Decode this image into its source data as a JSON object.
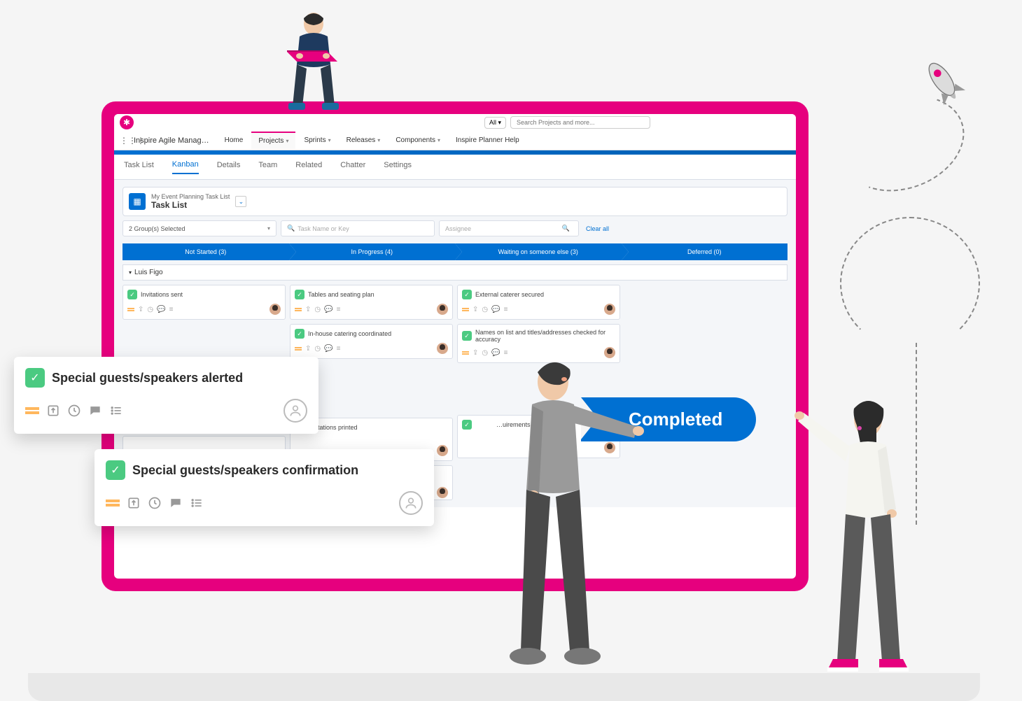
{
  "brand": {
    "search_filter": "All ▾",
    "search_placeholder": "Search Projects and more..."
  },
  "app_name": "Inspire Agile Manag…",
  "nav": {
    "home": "Home",
    "projects": "Projects",
    "sprints": "Sprints",
    "releases": "Releases",
    "components": "Components",
    "help": "Inspire Planner Help"
  },
  "tabs": {
    "task_list": "Task List",
    "kanban": "Kanban",
    "details": "Details",
    "team": "Team",
    "related": "Related",
    "chatter": "Chatter",
    "settings": "Settings"
  },
  "tasklist": {
    "subtitle": "My Event Planning Task List",
    "title": "Task List",
    "collapse": "⌄"
  },
  "filters": {
    "groups": "2 Group(s) Selected",
    "task_placeholder": "Task Name or Key",
    "assignee": "Assignee",
    "clear": "Clear all"
  },
  "statuses": {
    "not_started": "Not Started  (3)",
    "in_progress": "In Progress  (4)",
    "waiting": "Waiting on someone else  (3)",
    "deferred": "Deferred  (0)"
  },
  "swimlane": "Luis Figo",
  "cards": {
    "c1": "Invitations sent",
    "c2": "Tables and seating plan",
    "c3": "External caterer secured",
    "c4": "In-house catering coordinated",
    "c5": "Names on list and titles/addresses checked for accuracy",
    "c6": "Special guests/speakers alerted",
    "c7": "Invitations printed",
    "c8": "…uirements of attendees"
  },
  "popout": {
    "t1": "Special guests/speakers alerted",
    "t2": "Special guests/speakers confirmation"
  },
  "completed": "Completed"
}
